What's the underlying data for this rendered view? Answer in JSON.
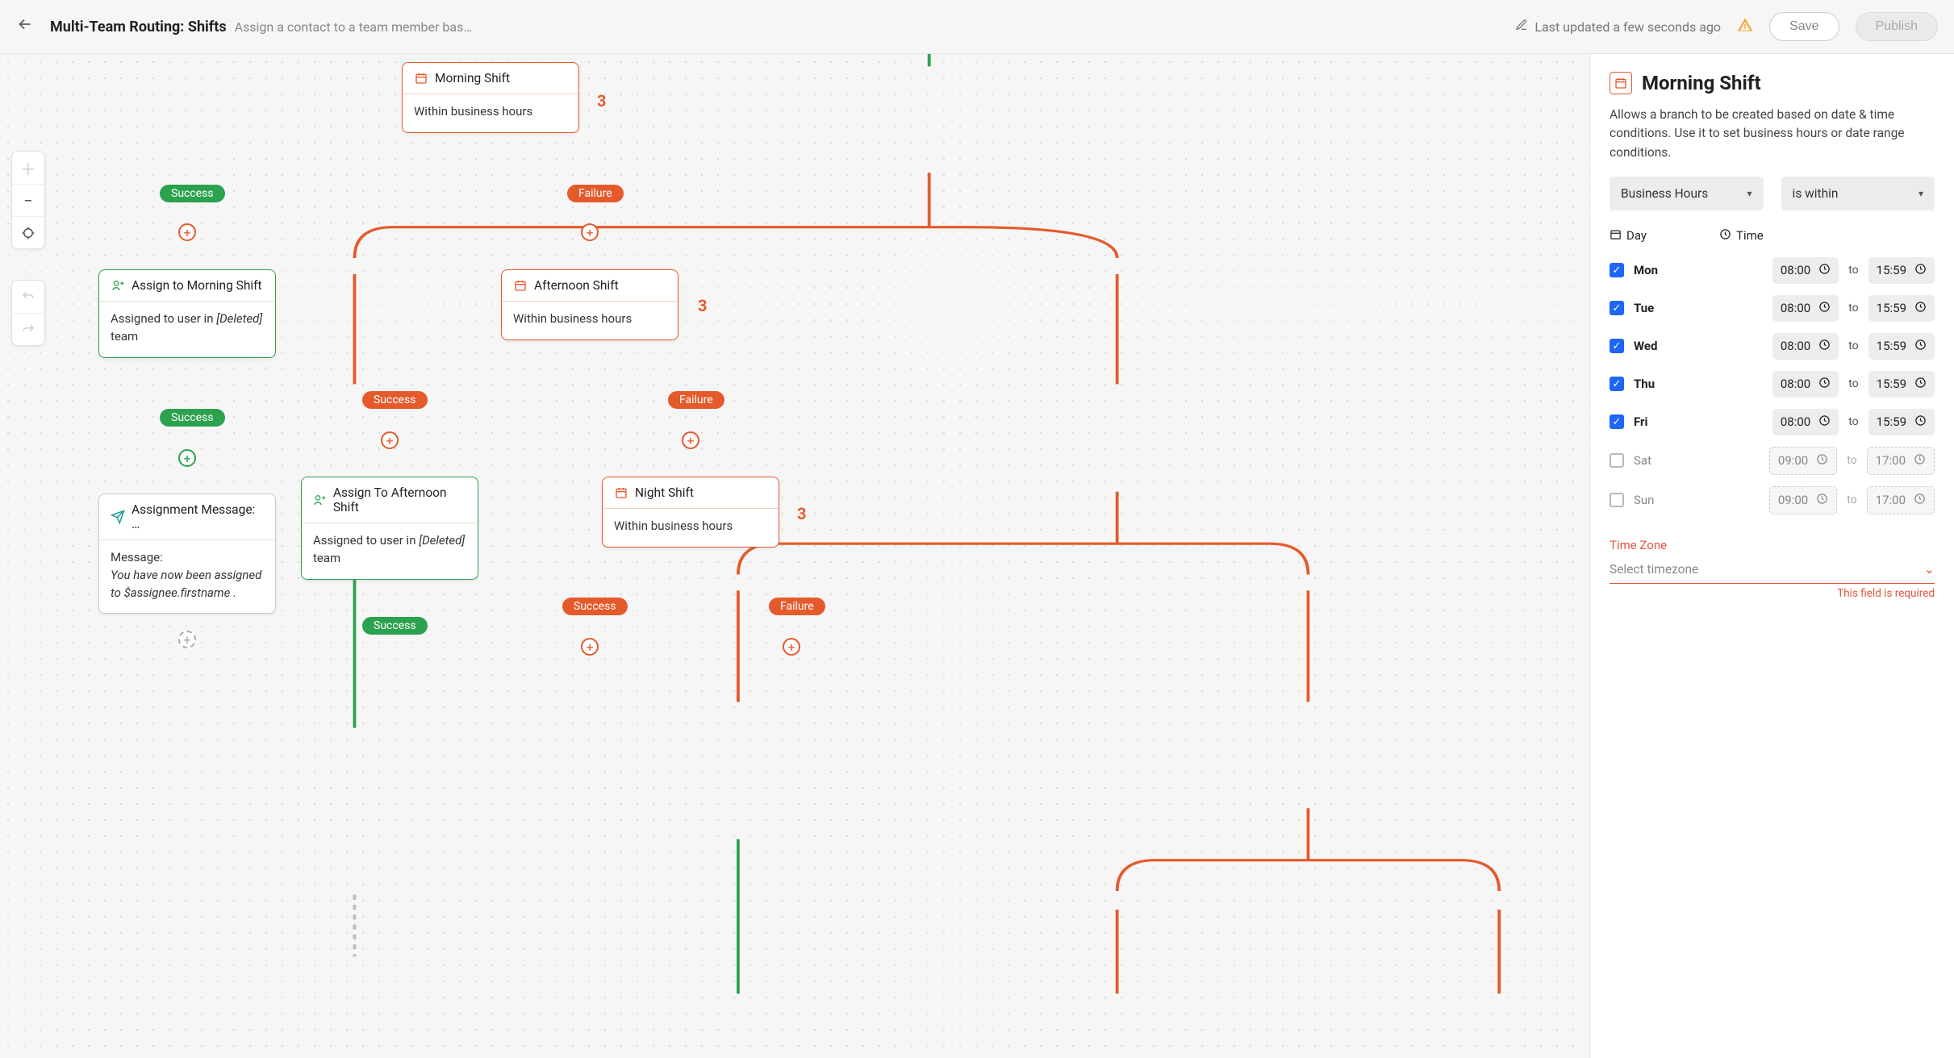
{
  "header": {
    "title": "Multi-Team Routing: Shifts",
    "subtitle": "Assign a contact to a team member based…",
    "last_updated": "Last updated a few seconds ago",
    "save_label": "Save",
    "publish_label": "Publish"
  },
  "canvas": {
    "nodes": {
      "morning": {
        "title": "Morning Shift",
        "body": "Within business hours",
        "err": "3"
      },
      "assign_morning": {
        "title": "Assign to Morning Shift",
        "body_pre": "Assigned to user in ",
        "deleted": "[Deleted]",
        "body_post": " team"
      },
      "afternoon": {
        "title": "Afternoon Shift",
        "body": "Within business hours",
        "err": "3"
      },
      "assign_afternoon": {
        "title": "Assign To Afternoon Shift",
        "body_pre": "Assigned to user in ",
        "deleted": "[Deleted]",
        "body_post": " team"
      },
      "night": {
        "title": "Night Shift",
        "body": "Within business hours",
        "err": "3"
      },
      "message": {
        "title": "Assignment Message: …",
        "msg_label": "Message:",
        "msg_body": "You have now been assigned to $assignee.firstname ."
      }
    },
    "pills": {
      "success": "Success",
      "failure": "Failure"
    }
  },
  "panel": {
    "title": "Morning Shift",
    "desc": "Allows a branch to be created based on date & time conditions. Use it to set business hours or date range conditions.",
    "select_condition": "Business Hours",
    "select_operator": "is within",
    "cols": {
      "day": "Day",
      "time": "Time"
    },
    "to": "to",
    "days": [
      {
        "label": "Mon",
        "checked": true,
        "from": "08:00",
        "to": "15:59"
      },
      {
        "label": "Tue",
        "checked": true,
        "from": "08:00",
        "to": "15:59"
      },
      {
        "label": "Wed",
        "checked": true,
        "from": "08:00",
        "to": "15:59"
      },
      {
        "label": "Thu",
        "checked": true,
        "from": "08:00",
        "to": "15:59"
      },
      {
        "label": "Fri",
        "checked": true,
        "from": "08:00",
        "to": "15:59"
      },
      {
        "label": "Sat",
        "checked": false,
        "from": "09:00",
        "to": "17:00"
      },
      {
        "label": "Sun",
        "checked": false,
        "from": "09:00",
        "to": "17:00"
      }
    ],
    "tz_label": "Time Zone",
    "tz_placeholder": "Select timezone",
    "tz_error": "This field is required"
  }
}
